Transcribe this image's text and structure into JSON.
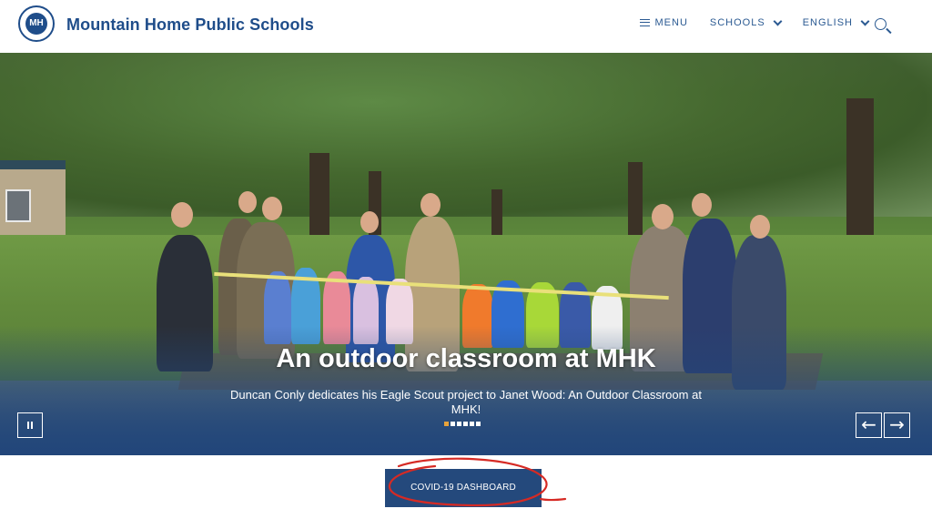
{
  "header": {
    "logo_text": "MH",
    "site_title": "Mountain Home Public Schools",
    "nav": {
      "menu_label": "MENU",
      "schools_label": "SCHOOLS",
      "language_label": "ENGLISH"
    },
    "icons": [
      "menu-icon",
      "chevron-down-icon",
      "search-icon"
    ]
  },
  "hero": {
    "title": "An outdoor classroom at MHK",
    "subtitle": "Duncan Conly dedicates his Eagle Scout project to Janet Wood: An Outdoor Classroom at MHK!",
    "slides_total": 6,
    "active_slide": 1,
    "prev_symbol": "←",
    "next_symbol": "→"
  },
  "cta": {
    "label": "COVID-19 DASHBOARD"
  },
  "colors": {
    "brand_blue": "#1f4d8a",
    "button_blue": "#24497c",
    "active_dot": "#e8a33b",
    "annotation_red": "#d62a24"
  }
}
